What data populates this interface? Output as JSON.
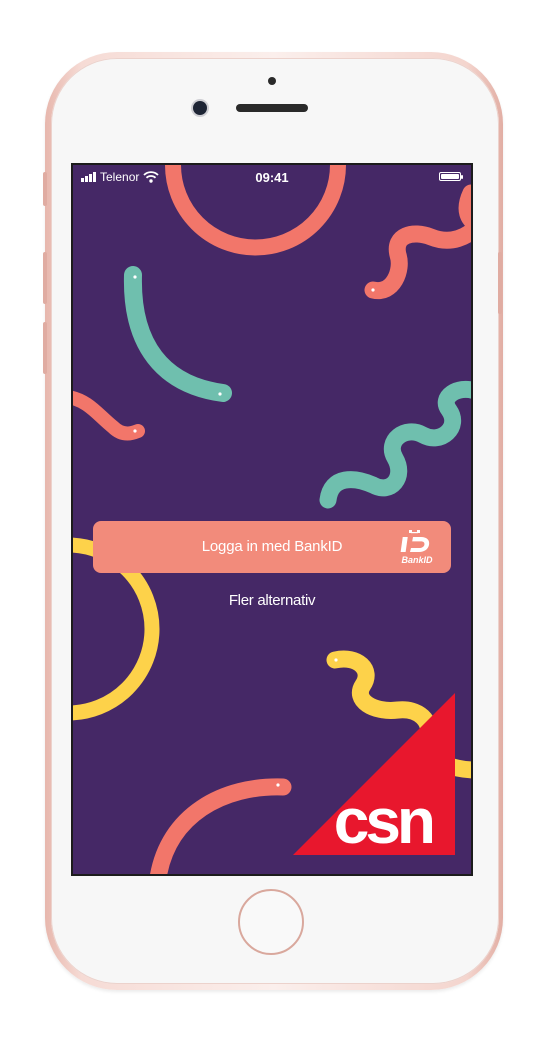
{
  "status_bar": {
    "carrier": "Telenor",
    "time": "09:41"
  },
  "login": {
    "bankid_label": "Logga in med BankID",
    "bankid_logo_text": "BankID",
    "more_options_label": "Fler alternativ"
  },
  "brand": {
    "logo_text": "csn",
    "logo_color": "#e8172d"
  },
  "colors": {
    "background": "#452866",
    "button": "#f28b7b",
    "coral": "#f2766a",
    "teal": "#6fbfae",
    "yellow": "#fdd24a"
  },
  "icons": [
    "signal-icon",
    "wifi-icon",
    "battery-icon",
    "bankid-icon"
  ]
}
